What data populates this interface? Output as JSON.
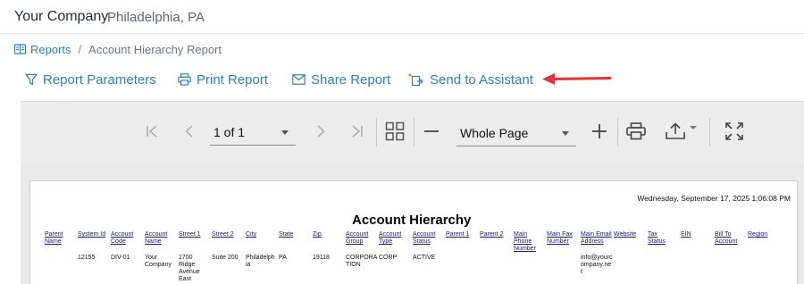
{
  "company": {
    "name": "Your Company",
    "location": "Philadelphia, PA"
  },
  "breadcrumb": {
    "root": "Reports",
    "separator": "/",
    "current": "Account Hierarchy Report",
    "root_icon": "reports-icon"
  },
  "toolbar": {
    "report_parameters": "Report Parameters",
    "print_report": "Print Report",
    "share_report": "Share Report",
    "send_to_assistant": "Send to Assistant",
    "accent_color": "#2f7fc1",
    "annotation_arrow_color": "#e0343a"
  },
  "viewer": {
    "page_select": "1 of 1",
    "zoom_select": "Whole Page"
  },
  "report": {
    "date": "Wednesday, September 17, 2025 1:06:08 PM",
    "title": "Account Hierarchy",
    "columns": [
      "Parent Name",
      "System Id",
      "Account Code",
      "Account Name",
      "Street 1",
      "Street 2",
      "City",
      "State",
      "Zip",
      "Account Group",
      "Account Type",
      "Account Status",
      "Parent 1",
      "Parent 2",
      "Main Phone Number",
      "Main Fax Number",
      "Main Email Address",
      "Website",
      "Tax Status",
      "EIN",
      "Bill To Account",
      "Region"
    ],
    "rows": [
      [
        "",
        "12155",
        "DIV-01",
        "Your Company",
        "1700 Ridge Avenue East",
        "Suite 200",
        "Philadelphia",
        "PA",
        "19118",
        "CORPORATION",
        "CORP",
        "ACTIVE",
        "",
        "",
        "",
        "",
        "info@yourcompany.net",
        "",
        "",
        "",
        "",
        ""
      ]
    ]
  }
}
